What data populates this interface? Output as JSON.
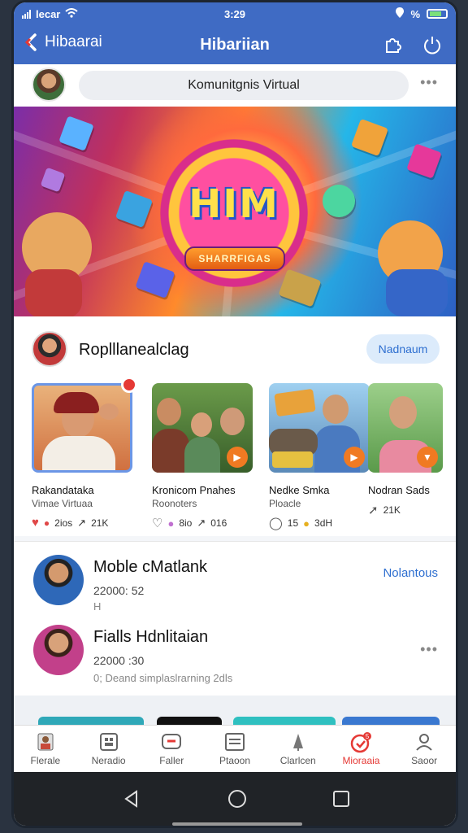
{
  "status_bar": {
    "carrier": "lecar",
    "time": "3:29",
    "battery_label": "%"
  },
  "app_bar": {
    "back_label": "Hibaarai",
    "title": "Hibariian"
  },
  "community": {
    "search_text": "Komunitgnis Virtual",
    "more": "•••"
  },
  "banner": {
    "logo_text": "HIM",
    "ribbon_text": "SHARRFIGAS"
  },
  "featured_section": {
    "title": "Roplllanealclag",
    "follow_label": "Nadnaum",
    "cards": [
      {
        "title": "Rakandataka",
        "subtitle": "Vimae Virtuaa",
        "likes": "2ios",
        "shares": "21K"
      },
      {
        "title": "Kronicom Pnahes",
        "subtitle": "Roonoters",
        "likes": "8io",
        "shares": "016"
      },
      {
        "title": "Nedke Smka",
        "subtitle": "Ploacle",
        "likes": "15",
        "shares": "3dH"
      },
      {
        "title": "Nodran Sads",
        "subtitle": "",
        "likes": "",
        "shares": "21K"
      }
    ]
  },
  "people": [
    {
      "name": "Moble cMatlank",
      "meta": "22000: 52",
      "meta2": "H",
      "action": "Nolantous"
    },
    {
      "name": "Fialls Hdnlitaian",
      "meta": "22000 :30",
      "meta2": "0; Deand simplaslrarning 2dls",
      "action": "•••"
    }
  ],
  "bottom_nav": [
    {
      "label": "Flerale",
      "icon": "person-card-icon"
    },
    {
      "label": "Neradio",
      "icon": "grid-icon"
    },
    {
      "label": "Faller",
      "icon": "chat-icon"
    },
    {
      "label": "Ptaoon",
      "icon": "list-icon"
    },
    {
      "label": "Clarlcen",
      "icon": "tree-icon"
    },
    {
      "label": "Mioraaia",
      "icon": "bell-icon",
      "badge": "5"
    },
    {
      "label": "Saoor",
      "icon": "profile-icon"
    }
  ],
  "colors": {
    "brand": "#3f6bc4",
    "accent": "#e53935",
    "link": "#2e6fd0"
  }
}
